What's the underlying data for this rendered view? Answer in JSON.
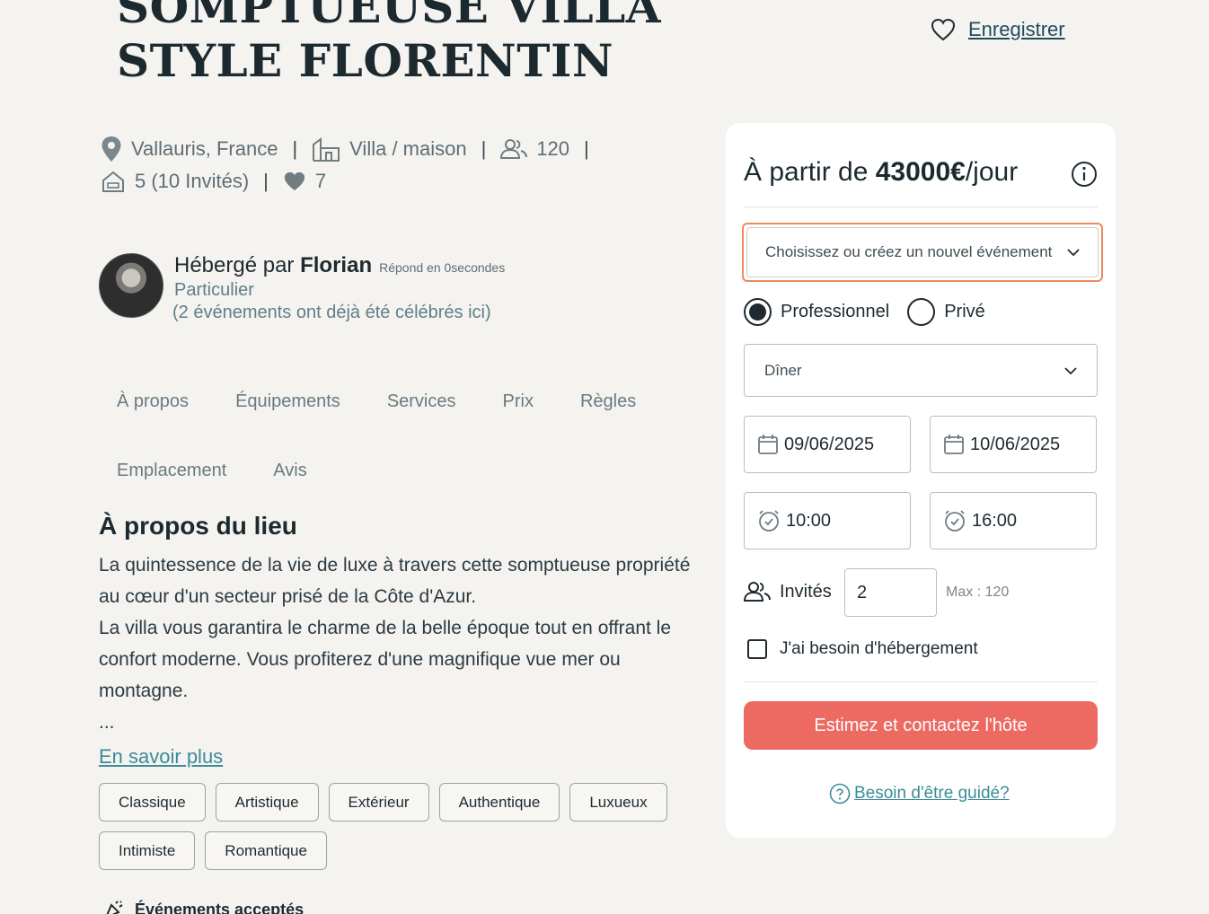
{
  "listing": {
    "title": "SOMPTUEUSE VILLA STYLE FLORENTIN",
    "save_label": "Enregistrer",
    "location": "Vallauris, France",
    "type": "Villa / maison",
    "capacity": "120",
    "rooms": "5 (10 Invités)",
    "likes": "7"
  },
  "host": {
    "prefix": "Hébergé par ",
    "name": "Florian",
    "response": "Répond en 0secondes",
    "kind": "Particulier",
    "events": "(2 événements ont déjà été célébrés ici)"
  },
  "tabs": [
    "À propos",
    "Équipements",
    "Services",
    "Prix",
    "Règles",
    "Emplacement",
    "Avis"
  ],
  "about": {
    "title": "À propos du lieu",
    "p1": "La quintessence de la vie de luxe à travers cette somptueuse propriété au cœur d'un secteur prisé de la Côte d'Azur.",
    "p2": "La villa vous garantira le charme de la belle époque tout en offrant le confort moderne. Vous profiterez d'une magnifique vue mer ou montagne.",
    "ellipsis": "...",
    "more": "En savoir plus"
  },
  "tags": [
    "Classique",
    "Artistique",
    "Extérieur",
    "Authentique",
    "Luxueux",
    "Intimiste",
    "Romantique"
  ],
  "events_accepted": "Événements acceptés",
  "booking": {
    "price_prefix": "À partir de ",
    "price": "43000€",
    "price_suffix": "/jour",
    "event_placeholder": "Choisissez ou créez un nouvel événement",
    "radio_pro": "Professionnel",
    "radio_private": "Privé",
    "selected_type": "Professionnel",
    "occasion": "Dîner",
    "date_start": "09/06/2025",
    "date_end": "10/06/2025",
    "time_start": "10:00",
    "time_end": "16:00",
    "guests_label": "Invités",
    "guests_value": "2",
    "guests_max": "Max : 120",
    "lodging_label": "J'ai besoin d'hébergement",
    "cta": "Estimez et contactez l'hôte",
    "help": "Besoin d'être guidé?"
  },
  "colors": {
    "accent": "#ec6a62",
    "focus": "#ee8a5e",
    "link": "#3d8b9a",
    "background": "#f4f3f0"
  }
}
